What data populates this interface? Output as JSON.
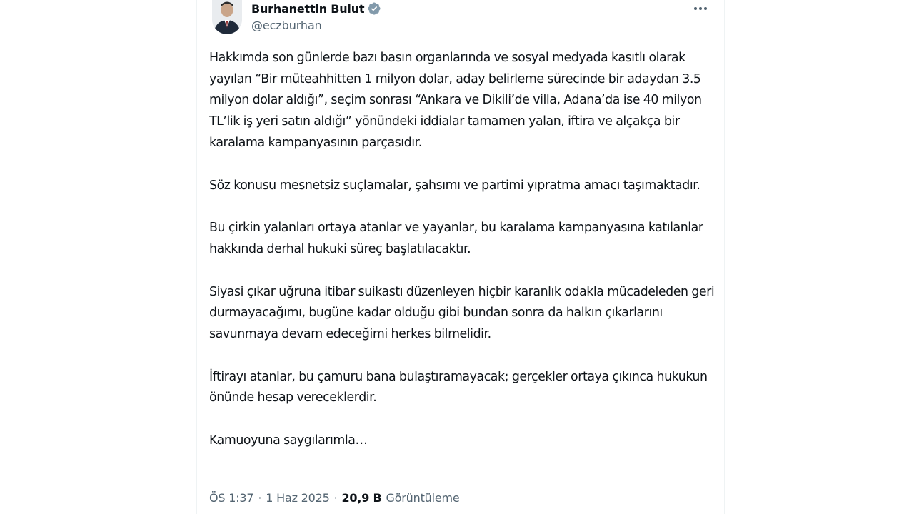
{
  "author": {
    "name": "Burhanettin Bulut",
    "handle": "@eczburhan",
    "verified": true,
    "avatar_icon": "user-avatar"
  },
  "more_icon": "more-horizontal-icon",
  "tweet": {
    "paragraphs": [
      "Hakkımda son günlerde bazı basın organlarında ve sosyal medyada kasıtlı olarak yayılan “Bir müteahhitten 1 milyon dolar, aday belirleme sürecinde bir adaydan 3.5 milyon dolar aldığı”, seçim sonrası “Ankara ve Dikili’de villa, Adana’da ise 40 milyon TL’lik iş yeri satın aldığı” yönündeki iddialar tamamen yalan, iftira ve alçakça bir karalama kampanyasının parçasıdır.",
      "Söz konusu mesnetsiz suçlamalar, şahsımı ve partimi yıpratma amacı taşımaktadır.",
      "Bu çirkin yalanları ortaya atanlar ve yayanlar, bu karalama kampanyasına katılanlar hakkında derhal hukuki süreç başlatılacaktır.",
      "Siyasi çıkar uğruna itibar suikastı düzenleyen hiçbir karanlık odakla mücadeleden geri durmayacağımı, bugüne kadar olduğu gibi bundan sonra da halkın çıkarlarını savunmaya devam edeceğimi herkes bilmelidir.",
      "İftirayı atanlar, bu çamuru bana bulaştıramayacak; gerçekler ortaya çıkınca hukukun önünde hesap vereceklerdir.",
      "Kamuoyuna saygılarımla…"
    ]
  },
  "meta": {
    "time": "ÖS 1:37",
    "date": "1 Haz 2025",
    "separator": "·",
    "views_count": "20,9 B",
    "views_label": "Görüntüleme"
  },
  "colors": {
    "text": "#0f1419",
    "secondary": "#536471",
    "verified": "#829aab",
    "border": "#eff3f4"
  }
}
